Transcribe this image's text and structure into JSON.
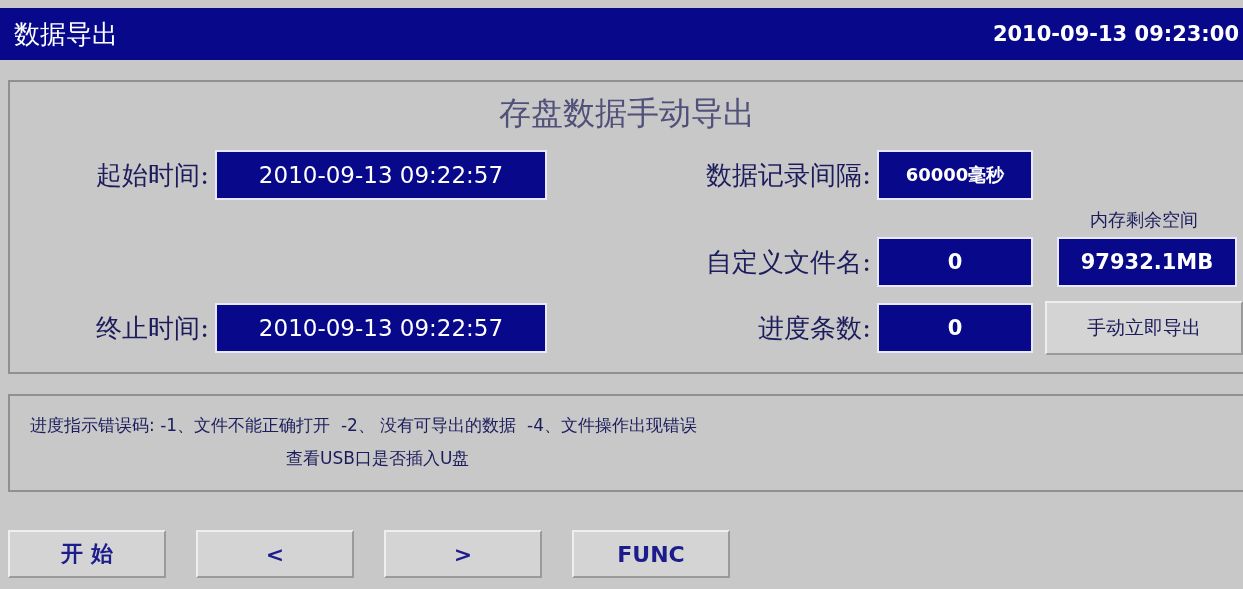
{
  "window": {
    "title": "数据导出",
    "datetime": "2010-09-13 09:23:00"
  },
  "panel": {
    "title": "存盘数据手动导出",
    "start_time": {
      "label": "起始时间:",
      "value": "2010-09-13 09:22:57"
    },
    "end_time": {
      "label": "终止时间:",
      "value": "2010-09-13 09:22:57"
    },
    "record_interval": {
      "label": "数据记录间隔:",
      "value": "60000毫秒"
    },
    "file_name": {
      "label": "自定义文件名:",
      "value": "0"
    },
    "progress_count": {
      "label": "进度条数:",
      "value": "0"
    },
    "memory_free": {
      "label": "内存剩余空间",
      "value": "97932.1MB"
    },
    "export_button": "手动立即导出"
  },
  "error_codes": [
    "进度指示错误码: -1、文件不能正确打开  -2、 没有可导出的数据  -4、文件操作出现错误",
    "查看USB口是否插入U盘"
  ],
  "buttons": [
    "开 始",
    "<",
    ">",
    "FUNC"
  ]
}
